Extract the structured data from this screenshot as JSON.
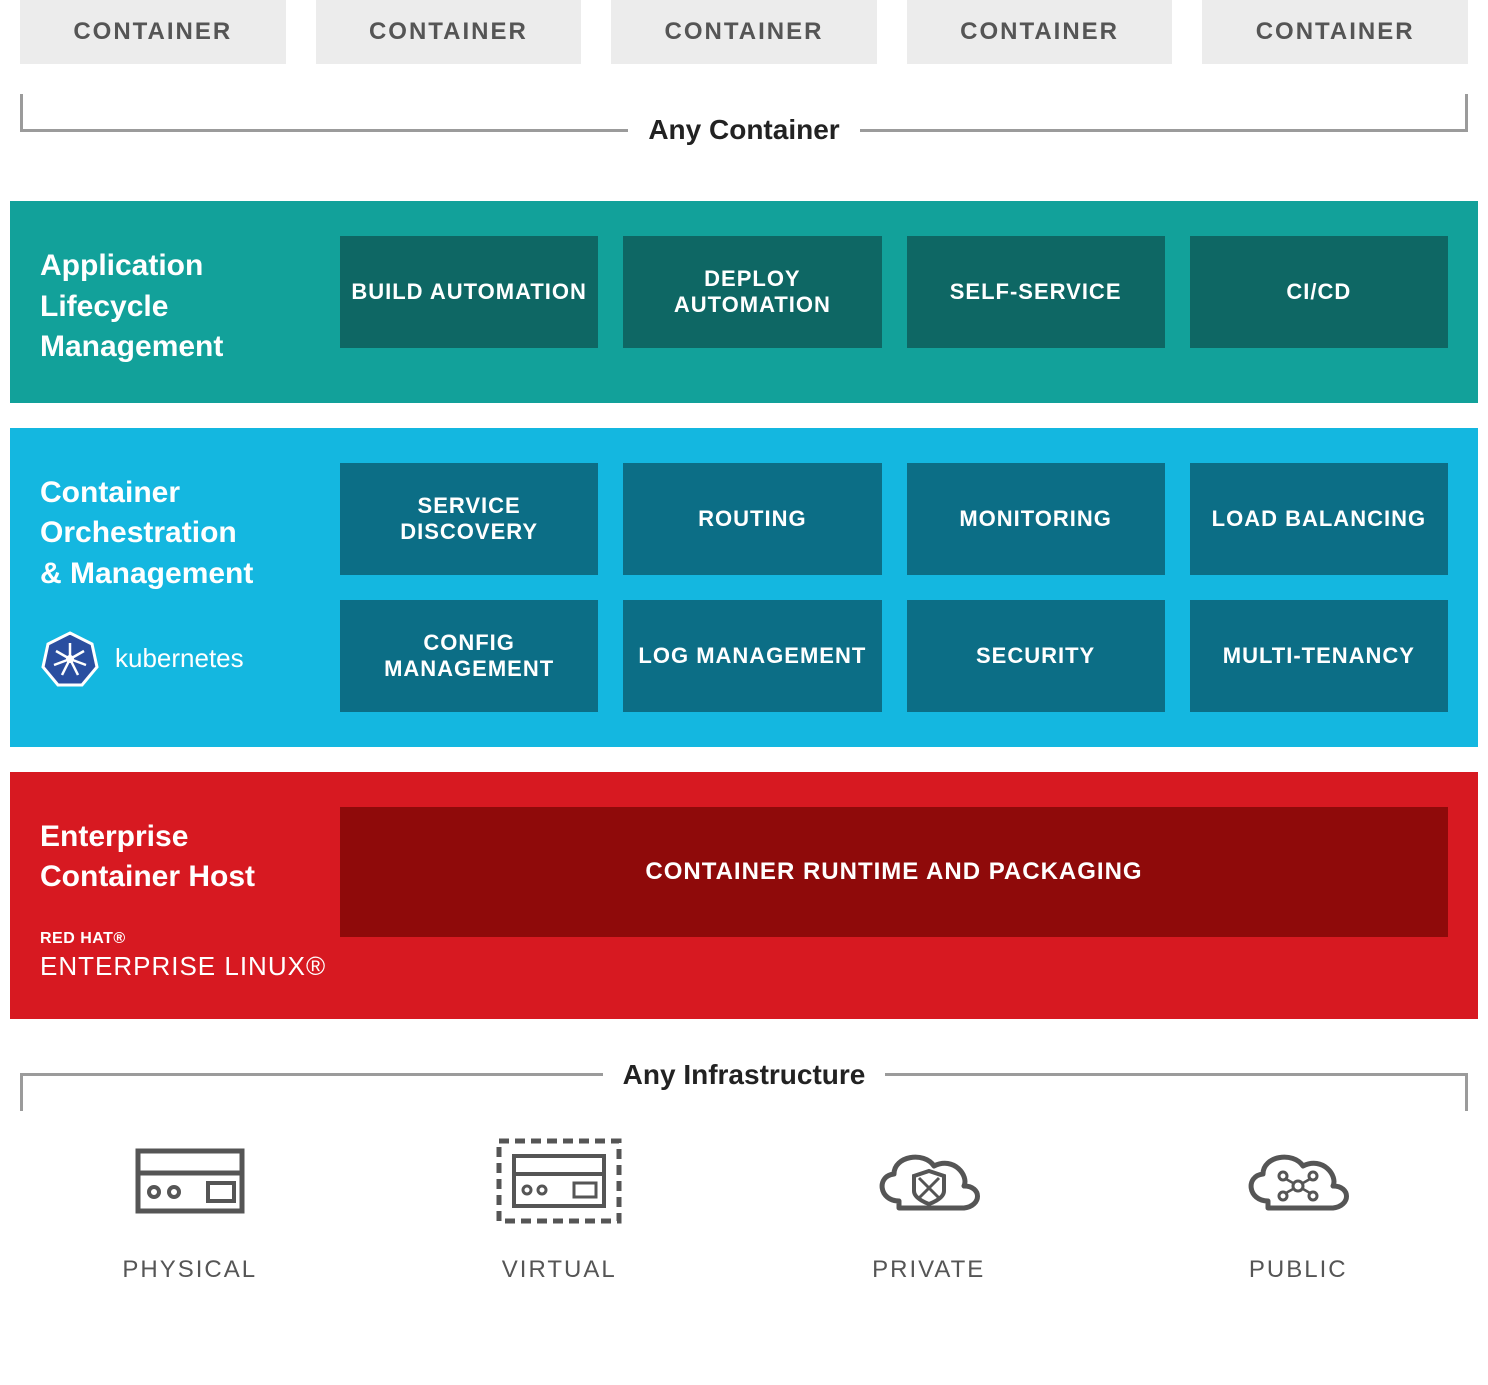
{
  "containers": {
    "items": [
      "CONTAINER",
      "CONTAINER",
      "CONTAINER",
      "CONTAINER",
      "CONTAINER"
    ],
    "bracket_label": "Any Container"
  },
  "layers": {
    "alm": {
      "title": "Application\nLifecycle\nManagement",
      "features": [
        "BUILD AUTOMATION",
        "DEPLOY AUTOMATION",
        "SELF-SERVICE",
        "CI/CD"
      ]
    },
    "orch": {
      "title": "Container\nOrchestration\n& Management",
      "brand": "kubernetes",
      "features_row1": [
        "SERVICE DISCOVERY",
        "ROUTING",
        "MONITORING",
        "LOAD BALANCING"
      ],
      "features_row2": [
        "CONFIG MANAGEMENT",
        "LOG MANAGEMENT",
        "SECURITY",
        "MULTI-TENANCY"
      ]
    },
    "host": {
      "title": "Enterprise\nContainer Host",
      "brand_top": "RED HAT®",
      "brand_bottom": "ENTERPRISE LINUX®",
      "feature": "CONTAINER RUNTIME AND PACKAGING"
    }
  },
  "infrastructure": {
    "bracket_label": "Any Infrastructure",
    "items": [
      {
        "label": "PHYSICAL",
        "icon": "server"
      },
      {
        "label": "VIRTUAL",
        "icon": "virtual"
      },
      {
        "label": "PRIVATE",
        "icon": "cloud-shield"
      },
      {
        "label": "PUBLIC",
        "icon": "cloud-network"
      }
    ]
  }
}
